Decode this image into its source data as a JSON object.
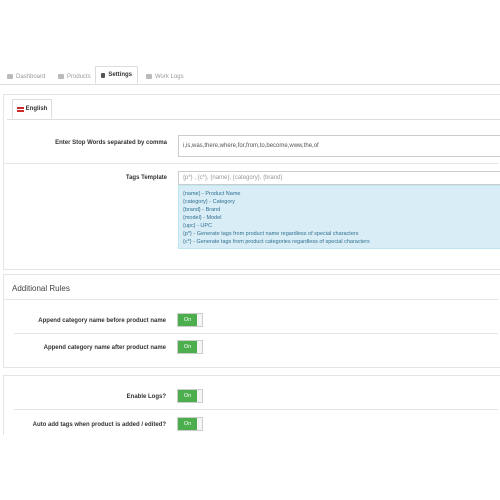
{
  "nav_tabs": [
    {
      "label": "Dashboard",
      "icon": "home-icon"
    },
    {
      "label": "Products",
      "icon": "list-icon"
    },
    {
      "label": "Settings",
      "icon": "gears-icon",
      "active": true
    },
    {
      "label": "Work Logs",
      "icon": "calendar-icon"
    }
  ],
  "language_tab": {
    "label": "English",
    "icon": "flag-icon"
  },
  "stop_words": {
    "label": "Enter Stop Words separated by comma",
    "value": "i,is,was,there,where,for,from,to,become,www,the,of"
  },
  "tags_template": {
    "label": "Tags Template",
    "placeholder": "{p*} , {c*}, {name}, {category}, {brand}",
    "help_lines": [
      "{name} - Product Name",
      "{category} - Category",
      "{brand} - Brand",
      "{model} - Model",
      "{upc} - UPC",
      "{p*} - Generate tags from product name regardless of special characters",
      "{c*} - Generate tags from product categories regardless of special characters"
    ]
  },
  "additional_rules": {
    "title": "Additional Rules",
    "rules": [
      {
        "label": "Append category name before product name",
        "toggle": "On"
      },
      {
        "label": "Append category name after product name",
        "toggle": "On"
      }
    ]
  },
  "logs": {
    "rules": [
      {
        "label": "Enable Logs?",
        "toggle": "On"
      },
      {
        "label": "Auto add tags when product is added / edited?",
        "toggle": "On"
      }
    ]
  },
  "colors": {
    "toggle_on": "#4cae4c",
    "info_bg": "#d9edf7",
    "info_text": "#31708f"
  }
}
